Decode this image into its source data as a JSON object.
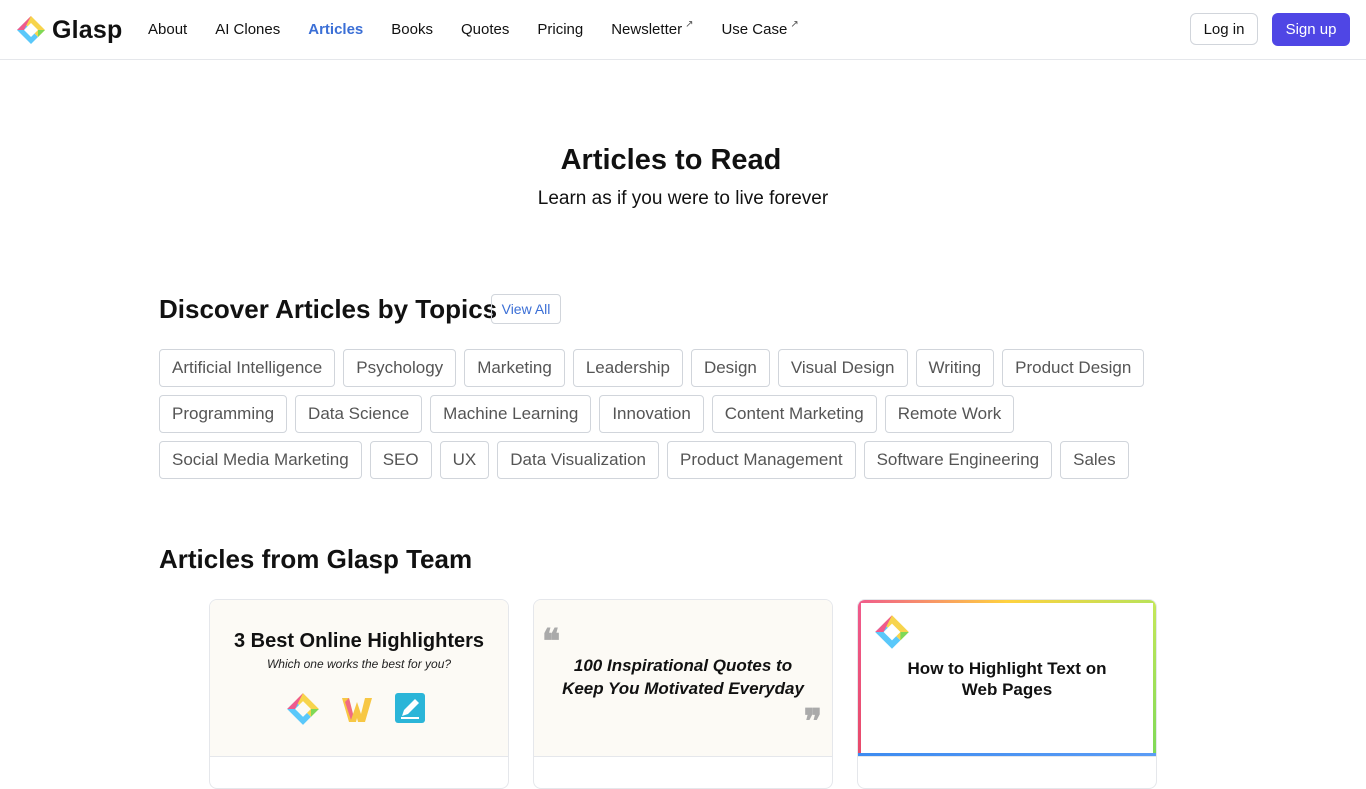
{
  "brand": {
    "name": "Glasp"
  },
  "nav": {
    "items": [
      {
        "label": "About"
      },
      {
        "label": "AI Clones"
      },
      {
        "label": "Articles"
      },
      {
        "label": "Books"
      },
      {
        "label": "Quotes"
      },
      {
        "label": "Pricing"
      },
      {
        "label": "Newsletter"
      },
      {
        "label": "Use Case"
      }
    ],
    "external_icon": "↗"
  },
  "auth": {
    "login_label": "Log in",
    "signup_label": "Sign up"
  },
  "hero": {
    "title": "Articles to Read",
    "subtitle": "Learn as if you were to live forever"
  },
  "topics": {
    "title": "Discover Articles by Topics",
    "view_all_label": "View All",
    "items": [
      "Artificial Intelligence",
      "Psychology",
      "Marketing",
      "Leadership",
      "Design",
      "Visual Design",
      "Writing",
      "Product Design",
      "Programming",
      "Data Science",
      "Machine Learning",
      "Innovation",
      "Content Marketing",
      "Remote Work",
      "Social Media Marketing",
      "SEO",
      "UX",
      "Data Visualization",
      "Product Management",
      "Software Engineering",
      "Sales"
    ]
  },
  "team_articles": {
    "title": "Articles from Glasp Team",
    "cards": [
      {
        "title": "3 Best Online Highlighters",
        "subtitle": "Which one works the best for you?"
      },
      {
        "title": "100 Inspirational Quotes to Keep You Motivated Everyday",
        "quote_open": "❝",
        "quote_close": "❞"
      },
      {
        "title": "How to Highlight Text on Web Pages"
      }
    ]
  },
  "colors": {
    "accent": "#4f46e5",
    "active_link": "#3b6fd6"
  }
}
